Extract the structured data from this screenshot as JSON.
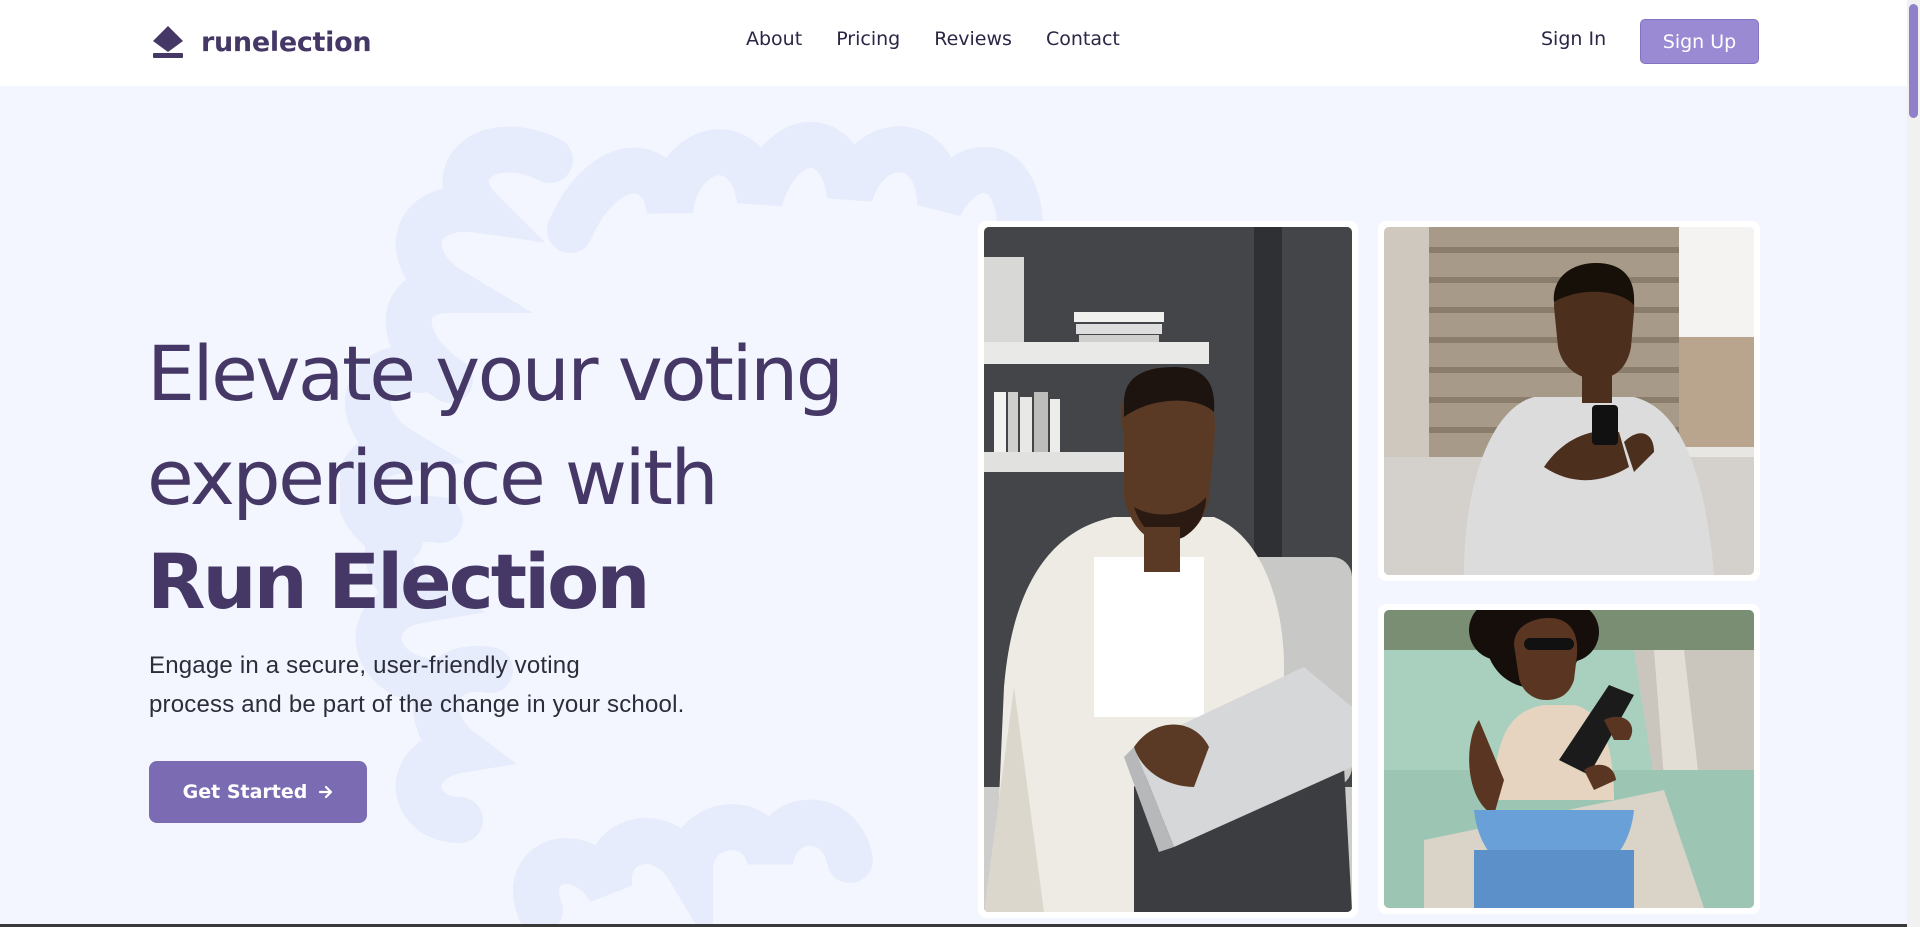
{
  "brand": {
    "name": "runelection"
  },
  "nav": {
    "items": [
      {
        "label": "About"
      },
      {
        "label": "Pricing"
      },
      {
        "label": "Reviews"
      },
      {
        "label": "Contact"
      }
    ],
    "sign_in_label": "Sign In",
    "sign_up_label": "Sign Up"
  },
  "hero": {
    "title_line_1": "Elevate your voting",
    "title_line_2": "experience with",
    "title_line_3": "Run Election",
    "subtitle_line_1": "Engage in a secure, user-friendly voting",
    "subtitle_line_2": "process and be part of the change in your school.",
    "cta_label": "Get Started"
  },
  "icons": {
    "logo": "brand-logo-icon",
    "cta_arrow": "arrow-right-icon"
  },
  "colors": {
    "brand_text": "#453867",
    "accent": "#9a8ad4",
    "cta": "#7a6bb3",
    "page_bg": "#f3f6fe"
  },
  "photos": [
    {
      "name": "man-with-laptop-photo"
    },
    {
      "name": "man-with-phone-photo"
    },
    {
      "name": "woman-with-tablet-photo"
    }
  ]
}
